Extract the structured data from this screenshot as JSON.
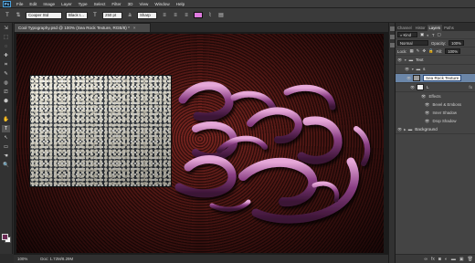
{
  "app": {
    "logo": "Ps"
  },
  "menu": [
    "File",
    "Edit",
    "Image",
    "Layer",
    "Type",
    "Select",
    "Filter",
    "3D",
    "View",
    "Window",
    "Help"
  ],
  "options_bar": {
    "tool_icon": "type-tool-icon",
    "orient_icon": "text-orientation-icon",
    "font_family": "Cooper Std",
    "font_style": "Black I...",
    "font_size": "250 pt",
    "anti_alias": "Sharp",
    "text_color": "#e07be0"
  },
  "document": {
    "tab_title": "Cool Typography.psd @ 100% (Sea Rock Texture, RGB/8) *",
    "close": "×"
  },
  "status": {
    "zoom": "100%",
    "doc_size": "Doc: 1.72M/8.29M"
  },
  "tools": [
    "⇲",
    "⬚",
    "◌",
    "✚",
    "⌗",
    "✎",
    "◍",
    "⎚",
    "⬢",
    "◐",
    "✋",
    "T",
    "↖",
    "▭",
    "☚",
    "🔍"
  ],
  "layers_panel": {
    "tabs": [
      "Channel",
      "Histor",
      "Layers",
      "Paths"
    ],
    "active_tab": "Layers",
    "filter_label": "Kind",
    "blend_mode": "Normal",
    "opacity_label": "Opacity:",
    "opacity_value": "100%",
    "lock_label": "Lock:",
    "fill_label": "Fill:",
    "fill_value": "100%",
    "layers": {
      "text_group": "Text",
      "s_group": "s",
      "texture": "Sea Rock Texture",
      "text_layer": "L",
      "effects": "Effects",
      "fx1": "Bevel & Emboss",
      "fx2": "Inner Shadow",
      "fx3": "Drop Shadow",
      "background": "Background"
    }
  }
}
